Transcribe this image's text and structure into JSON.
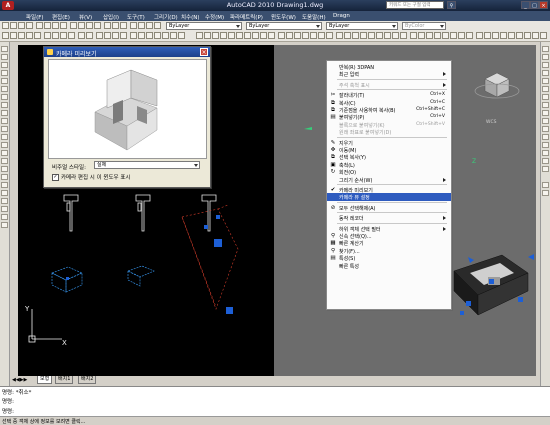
{
  "window": {
    "app_title": "AutoCAD 2010   Drawing1.dwg",
    "search_placeholder": "키워드 또는 구절 입력",
    "logo": "A"
  },
  "menubar": [
    "파일(F)",
    "편집(E)",
    "뷰(V)",
    "삽입(I)",
    "도구(T)",
    "그리기(D)",
    "치수(N)",
    "수정(M)",
    "파라메트릭(P)",
    "윈도우(W)",
    "도움말(H)",
    "Dragn"
  ],
  "toolbar": {
    "layer_combo": "ByLayer",
    "linetype_combo": "ByLayer",
    "lineweight_combo": "ByLayer",
    "plotstyle_combo": "ByColor"
  },
  "camera_preview": {
    "title": "카메라 미리보기",
    "visual_style_label": "비주얼 스타일:",
    "visual_style_value": "실제",
    "checkbox_label": "카메라 편집 시 이 윈도우 표시",
    "checkbox_checked": true
  },
  "context_menu": {
    "items": [
      {
        "label": "반복(R) 3DPAN",
        "shortcut": "",
        "icon": "",
        "disabled": false,
        "arrow": false
      },
      {
        "label": "최근 입력",
        "shortcut": "",
        "icon": "",
        "disabled": false,
        "arrow": true
      },
      {
        "sep": true
      },
      {
        "label": "주석 축척 표시",
        "shortcut": "",
        "icon": "",
        "disabled": true,
        "arrow": true
      },
      {
        "sep": true
      },
      {
        "label": "잘라내기(T)",
        "shortcut": "Ctrl+X",
        "icon": "✂",
        "disabled": false,
        "arrow": false
      },
      {
        "label": "복사(C)",
        "shortcut": "Ctrl+C",
        "icon": "⧉",
        "disabled": false,
        "arrow": false
      },
      {
        "label": "기준점을 사용하여 복사(B)",
        "shortcut": "Ctrl+Shift+C",
        "icon": "⧉",
        "disabled": false,
        "arrow": false
      },
      {
        "label": "붙여넣기(P)",
        "shortcut": "Ctrl+V",
        "icon": "▤",
        "disabled": false,
        "arrow": false
      },
      {
        "label": "블록으로 붙여넣기(K)",
        "shortcut": "Ctrl+Shift+V",
        "icon": "",
        "disabled": true,
        "arrow": false
      },
      {
        "label": "원래 좌표로 붙여넣기(D)",
        "shortcut": "",
        "icon": "",
        "disabled": true,
        "arrow": false
      },
      {
        "sep": true
      },
      {
        "label": "지우기",
        "shortcut": "",
        "icon": "✎",
        "disabled": false,
        "arrow": false
      },
      {
        "label": "이동(M)",
        "shortcut": "",
        "icon": "✥",
        "disabled": false,
        "arrow": false
      },
      {
        "label": "선택 복사(Y)",
        "shortcut": "",
        "icon": "⧉",
        "disabled": false,
        "arrow": false
      },
      {
        "label": "축척(L)",
        "shortcut": "",
        "icon": "▣",
        "disabled": false,
        "arrow": false
      },
      {
        "label": "회전(O)",
        "shortcut": "",
        "icon": "↻",
        "disabled": false,
        "arrow": false
      },
      {
        "label": "그리기 순서(W)",
        "shortcut": "",
        "icon": "",
        "disabled": false,
        "arrow": true
      },
      {
        "sep": true
      },
      {
        "label": "카메라 미리보기",
        "shortcut": "",
        "icon": "✔",
        "disabled": false,
        "arrow": false
      },
      {
        "label": "카메라 뷰 설정",
        "shortcut": "",
        "icon": "",
        "disabled": false,
        "arrow": false,
        "highlight": true
      },
      {
        "sep": true
      },
      {
        "label": "모두 선택해제(A)",
        "shortcut": "",
        "icon": "⊘",
        "disabled": false,
        "arrow": false
      },
      {
        "sep": true
      },
      {
        "label": "동작 레코더",
        "shortcut": "",
        "icon": "",
        "disabled": false,
        "arrow": true
      },
      {
        "sep": true
      },
      {
        "label": "하위 객체 선택 필터",
        "shortcut": "",
        "icon": "",
        "disabled": false,
        "arrow": true
      },
      {
        "label": "신속 선택(Q)...",
        "shortcut": "",
        "icon": "⚲",
        "disabled": false,
        "arrow": false
      },
      {
        "label": "빠른 계산기",
        "shortcut": "",
        "icon": "▦",
        "disabled": false,
        "arrow": false
      },
      {
        "label": "찾기(F)...",
        "shortcut": "",
        "icon": "⚲",
        "disabled": false,
        "arrow": false
      },
      {
        "label": "특성(S)",
        "shortcut": "",
        "icon": "▤",
        "disabled": false,
        "arrow": false
      },
      {
        "label": "빠른 특성",
        "shortcut": "",
        "icon": "",
        "disabled": false,
        "arrow": false
      }
    ]
  },
  "viewcube": {
    "label": "WCS"
  },
  "tabs": [
    "모형",
    "배치1",
    "배치2"
  ],
  "command": {
    "line1": "명령: *취소*",
    "line2": "명령:",
    "line3": "명령:"
  },
  "status": {
    "text": "선택 중 객체 상에 정보를 보려면 클릭..."
  },
  "axes": {
    "x": "X",
    "y": "Y",
    "z": "Z"
  },
  "colors": {
    "title_bar": "#1c2b45",
    "selection": "#2e5bbf",
    "viewport_left": "#000000",
    "viewport_right": "#6c6c6c",
    "camera_glyph": "#1d5fd6"
  }
}
